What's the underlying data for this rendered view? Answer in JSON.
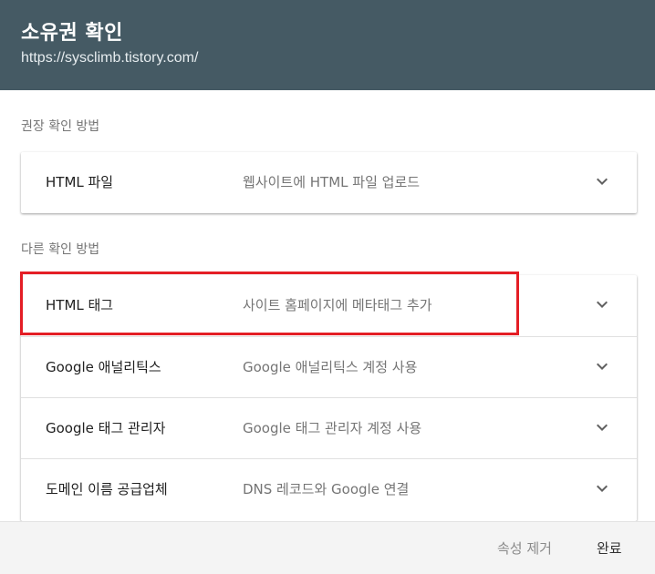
{
  "header": {
    "title": "소유권 확인",
    "url": "https://sysclimb.tistory.com/"
  },
  "sections": {
    "recommended_label": "권장 확인 방법",
    "other_label": "다른 확인 방법"
  },
  "recommended": [
    {
      "name": "HTML 파일",
      "desc": "웹사이트에 HTML 파일 업로드",
      "icon": "chevron-down-icon"
    }
  ],
  "other": [
    {
      "name": "HTML 태그",
      "desc": "사이트 홈페이지에 메타태그 추가",
      "icon": "chevron-down-icon"
    },
    {
      "name": "Google 애널리틱스",
      "desc": "Google 애널리틱스 계정 사용",
      "icon": "chevron-down-icon"
    },
    {
      "name": "Google 태그 관리자",
      "desc": "Google 태그 관리자 계정 사용",
      "icon": "chevron-down-icon"
    },
    {
      "name": "도메인 이름 공급업체",
      "desc": "DNS 레코드와 Google 연결",
      "icon": "chevron-down-icon"
    }
  ],
  "footer": {
    "remove_label": "속성 제거",
    "done_label": "완료"
  },
  "colors": {
    "header_bg": "#455a64",
    "highlight": "#e41e25"
  }
}
